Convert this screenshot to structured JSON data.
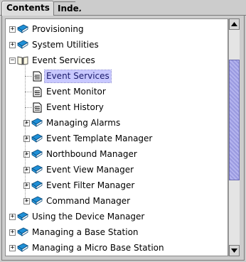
{
  "tabs": [
    {
      "label": "Contents",
      "active": true
    },
    {
      "label": "Index",
      "active": false
    }
  ],
  "tree": {
    "items": [
      {
        "label": "Provisioning",
        "type": "book",
        "expanded": false,
        "level": 0
      },
      {
        "label": "System Utilities",
        "type": "book",
        "expanded": false,
        "level": 0
      },
      {
        "label": "Event Services",
        "type": "book-open",
        "expanded": true,
        "level": 0
      },
      {
        "label": "Event Services",
        "type": "page",
        "level": 1,
        "selected": true
      },
      {
        "label": "Event Monitor",
        "type": "page",
        "level": 1
      },
      {
        "label": "Event History",
        "type": "page",
        "level": 1
      },
      {
        "label": "Managing Alarms",
        "type": "book",
        "expanded": false,
        "level": 1
      },
      {
        "label": "Event Template Manager",
        "type": "book",
        "expanded": false,
        "level": 1
      },
      {
        "label": "Northbound Manager",
        "type": "book",
        "expanded": false,
        "level": 1
      },
      {
        "label": "Event View Manager",
        "type": "book",
        "expanded": false,
        "level": 1
      },
      {
        "label": "Event Filter Manager",
        "type": "book",
        "expanded": false,
        "level": 1
      },
      {
        "label": "Command Manager",
        "type": "book",
        "expanded": false,
        "level": 1
      },
      {
        "label": "Using the Device Manager",
        "type": "book",
        "expanded": false,
        "level": 0
      },
      {
        "label": "Managing a Base Station",
        "type": "book",
        "expanded": false,
        "level": 0
      },
      {
        "label": "Managing a Micro Base Station",
        "type": "book",
        "expanded": false,
        "level": 0
      }
    ]
  },
  "scrollbar": {
    "thumb_start_fraction": 0.14,
    "thumb_size_fraction": 0.56
  },
  "colors": {
    "book": "#1f8fd6",
    "selection": "#c8c8ff",
    "thumb": "#9a9ae0"
  },
  "icons": {
    "collapsed": "plus-icon",
    "expanded": "minus-icon",
    "book": "book-icon",
    "book_open": "open-book-icon",
    "page": "page-icon",
    "scroll_up": "arrow-up-icon",
    "scroll_down": "arrow-down-icon"
  }
}
